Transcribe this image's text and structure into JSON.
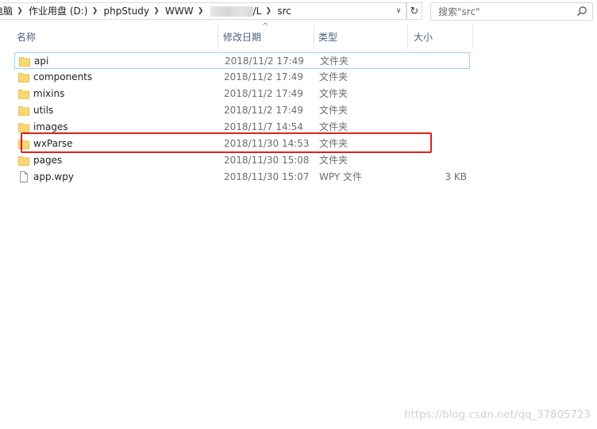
{
  "breadcrumb": {
    "items": [
      "电脑",
      "作业用盘 (D:)",
      "phpStudy",
      "WWW",
      "/L",
      "src"
    ]
  },
  "search": {
    "placeholder": "搜索\"src\""
  },
  "columns": {
    "name": "名称",
    "date": "修改日期",
    "type": "类型",
    "size": "大小"
  },
  "files": [
    {
      "name": "api",
      "date": "2018/11/2 17:49",
      "type": "文件夹",
      "size": "",
      "icon": "folder-icon"
    },
    {
      "name": "components",
      "date": "2018/11/2 17:49",
      "type": "文件夹",
      "size": "",
      "icon": "folder-icon"
    },
    {
      "name": "mixins",
      "date": "2018/11/2 17:49",
      "type": "文件夹",
      "size": "",
      "icon": "folder-icon"
    },
    {
      "name": "utils",
      "date": "2018/11/2 17:49",
      "type": "文件夹",
      "size": "",
      "icon": "folder-icon"
    },
    {
      "name": "images",
      "date": "2018/11/7 14:54",
      "type": "文件夹",
      "size": "",
      "icon": "folder-icon"
    },
    {
      "name": "wxParse",
      "date": "2018/11/30 14:53",
      "type": "文件夹",
      "size": "",
      "icon": "folder-icon"
    },
    {
      "name": "pages",
      "date": "2018/11/30 15:08",
      "type": "文件夹",
      "size": "",
      "icon": "folder-icon"
    },
    {
      "name": "app.wpy",
      "date": "2018/11/30 15:07",
      "type": "WPY 文件",
      "size": "3 KB",
      "icon": "file-icon"
    }
  ],
  "watermark": "https://blog.csdn.net/qq_37805723",
  "colors": {
    "folder": "#f8d775",
    "highlight": "#e0201b",
    "header_text": "#4c607a",
    "focus_border": "#99d1ff"
  }
}
